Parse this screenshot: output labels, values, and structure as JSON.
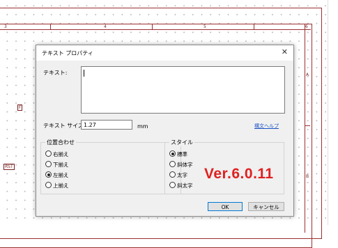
{
  "schematic": {
    "ruler_top": [
      "3",
      "4",
      "5",
      "6"
    ],
    "ruler_right": [
      "A",
      "B"
    ],
    "ports": [
      "F",
      "RST"
    ]
  },
  "dialog": {
    "title": "テキスト プロパティ",
    "close_icon": "close-icon",
    "text_label": "テキスト:",
    "text_value": "",
    "size_label": "テキスト サイズ:",
    "size_value": "1.27",
    "size_unit": "mm",
    "help_link": "構文ヘルプ",
    "alignment": {
      "legend": "位置合わせ",
      "options": [
        "右揃え",
        "下揃え",
        "左揃え",
        "上揃え"
      ],
      "selected": "左揃え"
    },
    "style": {
      "legend": "スタイル",
      "options": [
        "標準",
        "斜体字",
        "太字",
        "斜太字"
      ],
      "selected": "標準"
    },
    "ok_label": "OK",
    "cancel_label": "キャンセル"
  },
  "overlay": {
    "version_text": "Ver.6.0.11",
    "version_color": "#e02020"
  }
}
